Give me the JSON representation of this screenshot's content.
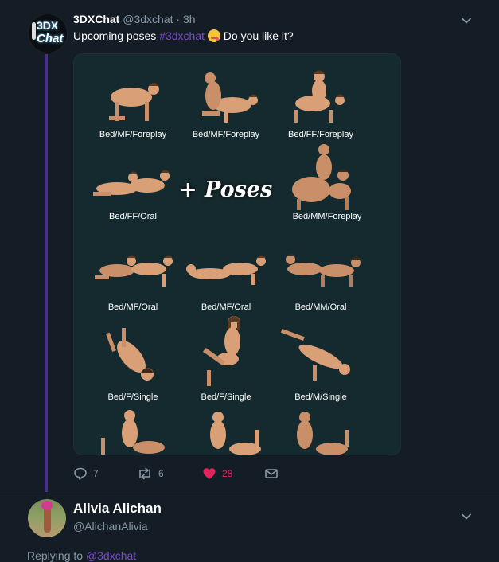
{
  "tweet": {
    "author_name": "3DXChat",
    "author_handle": "@3dxchat",
    "separator": "·",
    "time": "3h",
    "avatar_text_line1": "3DX",
    "avatar_text_line2": "Chat",
    "text_before": "Upcoming poses",
    "hashtag": "#3dxchat",
    "text_after": "Do you like it?",
    "media": {
      "overlay_text": "+ Poses",
      "captions": [
        "Bed/MF/Foreplay",
        "Bed/MF/Foreplay",
        "Bed/FF/Foreplay",
        "Bed/FF/Oral",
        "Bed/MM/Foreplay",
        "Bed/MF/Oral",
        "Bed/MF/Oral",
        "Bed/MM/Oral",
        "Bed/F/Single",
        "Bed/F/Single",
        "Bed/M/Single"
      ]
    },
    "actions": {
      "reply_count": "7",
      "retweet_count": "6",
      "like_count": "28"
    }
  },
  "reply": {
    "author_name": "Alivia Alichan",
    "author_handle": "@AlichanAlivia",
    "replying_prefix": "Replying to",
    "replying_to": "@3dxchat"
  },
  "colors": {
    "background": "#141d26",
    "accent": "#794bc4",
    "like": "#e0245e",
    "muted": "#8899a6"
  },
  "icons": [
    "chevron-down-icon",
    "reply-icon",
    "retweet-icon",
    "heart-icon",
    "envelope-icon"
  ]
}
